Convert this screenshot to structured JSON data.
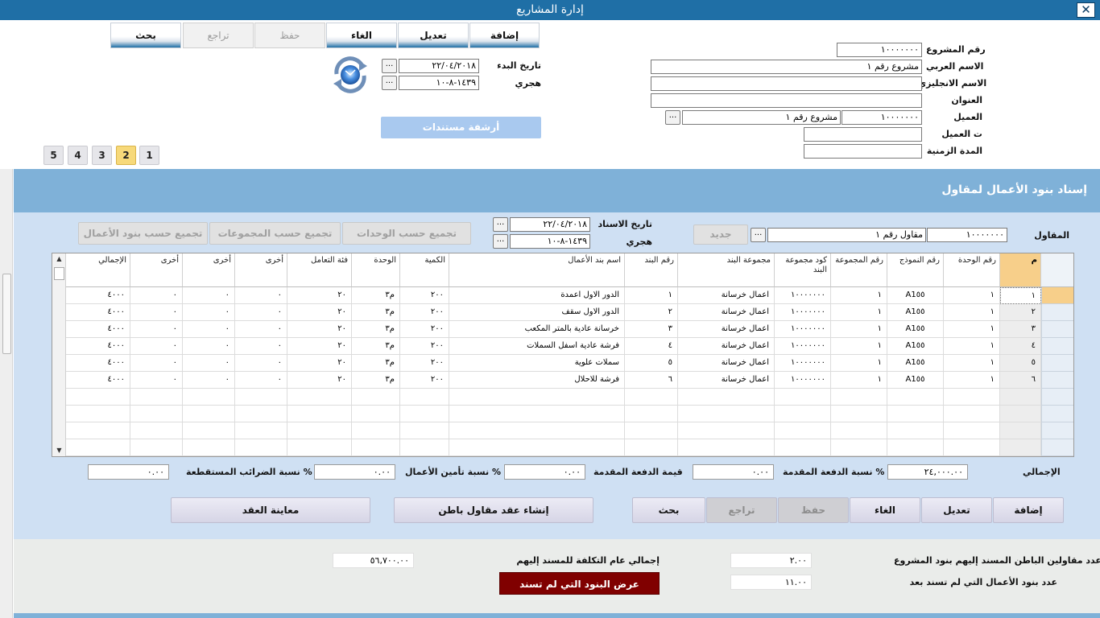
{
  "window": {
    "title": "إدارة المشاريع",
    "close_glyph": "✕"
  },
  "toolbar": {
    "add": "إضافة",
    "edit": "تعديل",
    "cancel": "الغاء",
    "save": "حفظ",
    "undo": "تراجع",
    "search": "بحث"
  },
  "project": {
    "number_label": "رقم المشروع",
    "number": "١٠٠٠٠٠٠٠",
    "arabic_name_label": "الاسم العربي",
    "arabic_name": "مشروع رقم ١",
    "english_name_label": "الاسم الانجليزي",
    "english_name": "",
    "address_label": "العنوان",
    "address": "",
    "client_label": "العميل",
    "client_code": "١٠٠٠٠٠٠٠",
    "client_name": "مشروع رقم ١",
    "client_phone_label": "ت العميل",
    "client_phone": "",
    "duration_label": "المدة الزمنية",
    "duration": "",
    "start_date_label": "تاريخ البدء",
    "start_date": "٢٢/٠٤/٢٠١٨",
    "hijri_label": "هجري",
    "hijri_date": "١٤٣٩-٨-١٠",
    "dots": "...",
    "archive_button": "أرشفة مستندات"
  },
  "pages": [
    "1",
    "2",
    "3",
    "4",
    "5"
  ],
  "active_page": "2",
  "section": {
    "title": "إسناد بنود الأعمال لمقاول",
    "contractor_label": "المقاول",
    "contractor_code": "١٠٠٠٠٠٠٠",
    "contractor_name": "مقاول رقم ١",
    "new_button": "جديد",
    "assign_date_label": "تاريخ الاسناد",
    "assign_date": "٢٢/٠٤/٢٠١٨",
    "hijri_label": "هجري",
    "hijri_date": "١٤٣٩-٨-١٠",
    "group_by_units": "تجميع حسب الوحدات",
    "group_by_groups": "تجميع حسب المجموعات",
    "group_by_items": "تجميع حسب بنود الأعمال"
  },
  "grid": {
    "columns": [
      "م",
      "رقم الوحدة",
      "رقم النموذج",
      "رقم المجموعة",
      "كود مجموعة البند",
      "مجموعة البند",
      "رقم البند",
      "اسم بند الأعمال",
      "الكمية",
      "الوحدة",
      "فئة التعامل",
      "أخرى",
      "أخرى",
      "أخرى",
      "الإجمالي"
    ],
    "rows": [
      [
        "١",
        "١",
        "A1٥٥",
        "١",
        "١٠٠٠٠٠٠٠",
        "اعمال خرسانة",
        "١",
        "الدور الاول اعمدة",
        "٢٠٠",
        "م٣",
        "٢٠",
        "٠",
        "٠",
        "٠",
        "٤٠٠٠"
      ],
      [
        "٢",
        "١",
        "A1٥٥",
        "١",
        "١٠٠٠٠٠٠٠",
        "اعمال خرسانة",
        "٢",
        "الدور الاول سقف",
        "٢٠٠",
        "م٣",
        "٢٠",
        "٠",
        "٠",
        "٠",
        "٤٠٠٠"
      ],
      [
        "٣",
        "١",
        "A1٥٥",
        "١",
        "١٠٠٠٠٠٠٠",
        "اعمال خرسانة",
        "٣",
        "خرسانة عادية بالمتر المكعب",
        "٢٠٠",
        "م٣",
        "٢٠",
        "٠",
        "٠",
        "٠",
        "٤٠٠٠"
      ],
      [
        "٤",
        "١",
        "A1٥٥",
        "١",
        "١٠٠٠٠٠٠٠",
        "اعمال خرسانة",
        "٤",
        "فرشة عادية اسفل السملات",
        "٢٠٠",
        "م٣",
        "٢٠",
        "٠",
        "٠",
        "٠",
        "٤٠٠٠"
      ],
      [
        "٥",
        "١",
        "A1٥٥",
        "١",
        "١٠٠٠٠٠٠٠",
        "اعمال خرسانة",
        "٥",
        "سملات علوية",
        "٢٠٠",
        "م٣",
        "٢٠",
        "٠",
        "٠",
        "٠",
        "٤٠٠٠"
      ],
      [
        "٦",
        "١",
        "A1٥٥",
        "١",
        "١٠٠٠٠٠٠٠",
        "اعمال خرسانة",
        "٦",
        "فرشة للاحلال",
        "٢٠٠",
        "م٣",
        "٢٠",
        "٠",
        "٠",
        "٠",
        "٤٠٠٠"
      ]
    ],
    "scroll_up": "▲",
    "scroll_down": "▼"
  },
  "summary": {
    "total_label": "الإجمالي",
    "total": "٢٤,٠٠٠.٠٠",
    "advance_pct_label": "نسبة الدفعة المقدمة %",
    "advance_pct": "٠.٠٠",
    "advance_value_label": "قيمة الدفعة المقدمة",
    "advance_value": "٠.٠٠",
    "insurance_label": "نسبة تأمين الأعمال %",
    "insurance": "٠.٠٠",
    "tax_label": "نسبة الضرائب المستقطعة %",
    "tax": "٠.٠٠"
  },
  "actions": {
    "add": "إضافة",
    "edit": "تعديل",
    "cancel": "الغاء",
    "save": "حفظ",
    "undo": "تراجع",
    "search": "بحث",
    "create_contract": "إنشاء عقد مقاول باطن",
    "preview_contract": "معاينة العقد"
  },
  "bottom": {
    "subcontractors_count_label": "عدد مقاولين الباطن المسند إليهم بنود المشروع",
    "subcontractors_count": "٢.٠٠",
    "unassigned_count_label": "عدد بنود الأعمال التي لم تسند بعد",
    "unassigned_count": "١١.٠٠",
    "total_cost_label": "إجمالي عام التكلفة للمسند إليهم",
    "total_cost": "٥٦,٧٠٠.٠٠",
    "show_unassigned_button": "عرض البنود التي لم تسند"
  },
  "colors": {
    "titlebar": "#1f6fa6",
    "section_header": "#7fb1d8",
    "section_body": "#cfe0f3",
    "selected_header": "#f7cf8a",
    "danger_button": "#800000"
  }
}
